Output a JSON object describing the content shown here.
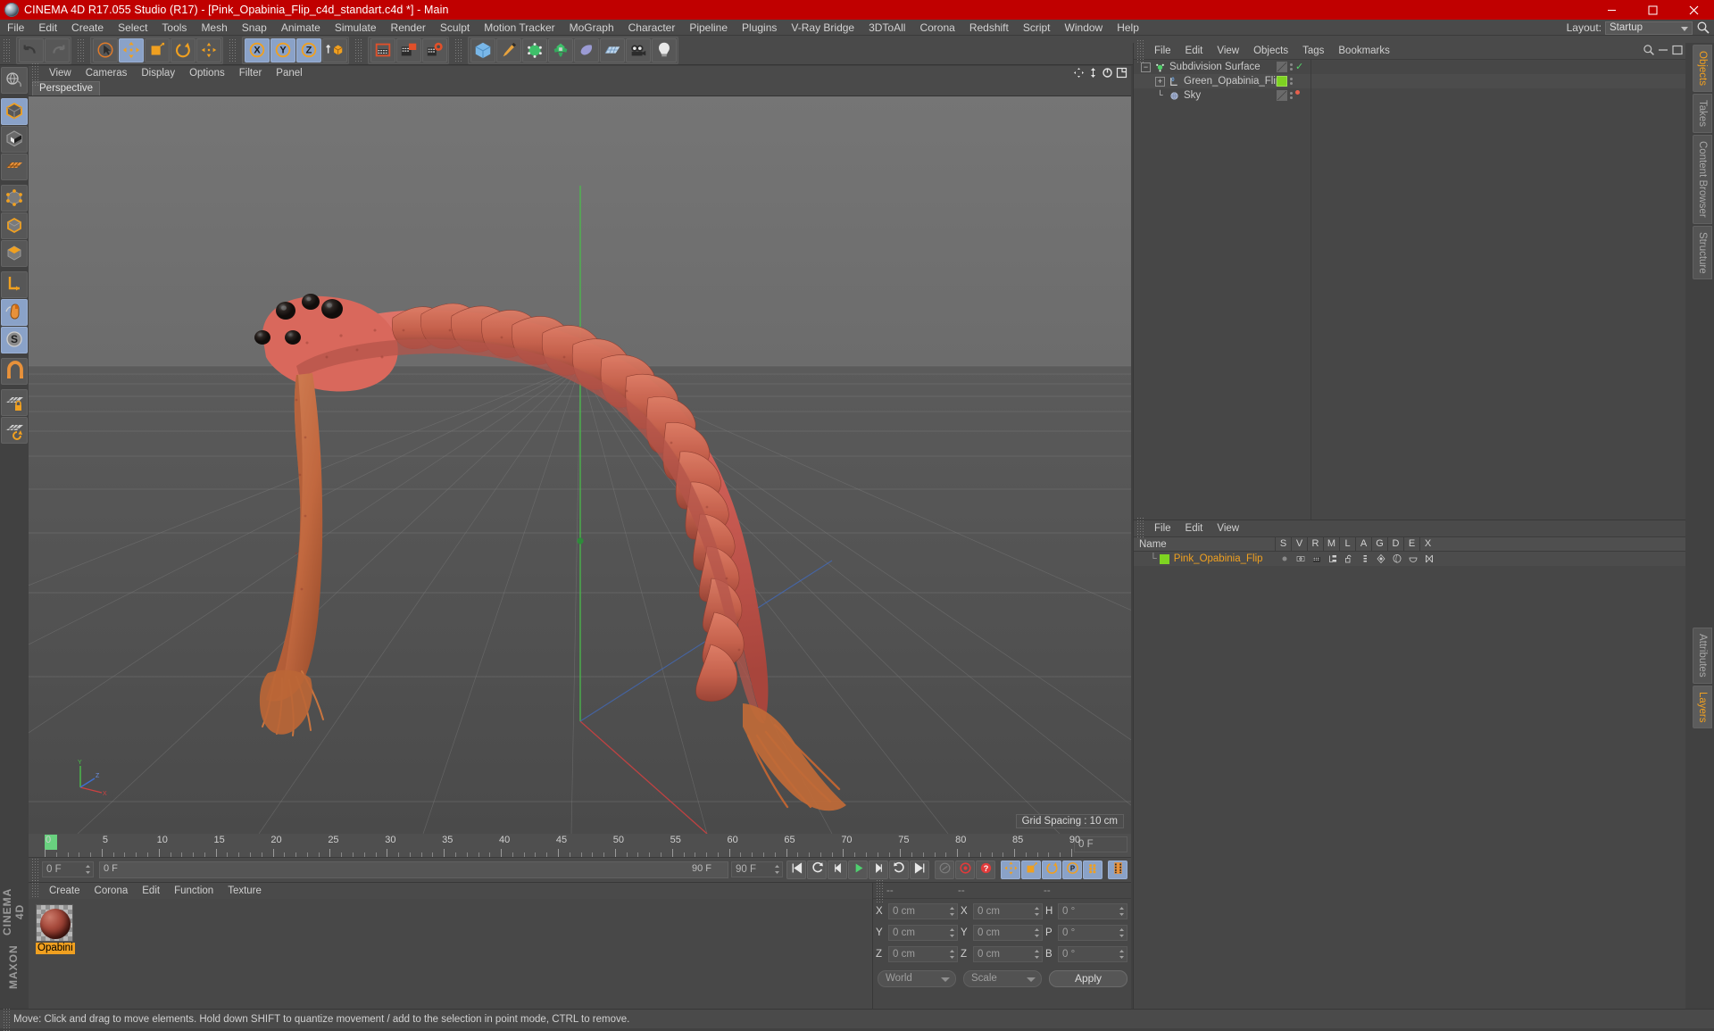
{
  "window": {
    "title": "CINEMA 4D R17.055 Studio (R17) - [Pink_Opabinia_Flip_c4d_standart.c4d *] - Main",
    "minimize": "minimize-icon",
    "maximize": "maximize-icon",
    "close": "close-icon",
    "accent_red": "#c00000"
  },
  "menubar": {
    "items": [
      "File",
      "Edit",
      "Create",
      "Select",
      "Tools",
      "Mesh",
      "Snap",
      "Animate",
      "Simulate",
      "Render",
      "Sculpt",
      "Motion Tracker",
      "MoGraph",
      "Character",
      "Pipeline",
      "Plugins",
      "V-Ray Bridge",
      "3DToAll",
      "Corona",
      "Redshift",
      "Script",
      "Window",
      "Help"
    ],
    "layout_label": "Layout:",
    "layout_value": "Startup",
    "search_icon": "magnifier-icon"
  },
  "toolbar": {
    "groups": [
      {
        "name": "undo-redo",
        "buttons": [
          {
            "name": "undo-button",
            "icon": "undo-arrow-icon",
            "active": false
          },
          {
            "name": "redo-button",
            "icon": "redo-arrow-icon",
            "active": false
          }
        ]
      },
      {
        "name": "transform-tools",
        "buttons": [
          {
            "name": "live-selection-tool",
            "icon": "cursor-circle-icon",
            "active": false
          },
          {
            "name": "move-tool",
            "icon": "move-cross-icon",
            "active": true
          },
          {
            "name": "scale-tool",
            "icon": "scale-box-icon",
            "active": false
          },
          {
            "name": "rotate-tool",
            "icon": "rotate-circle-icon",
            "active": false
          },
          {
            "name": "free-move-tool",
            "icon": "move-cross-alt-icon",
            "active": false
          }
        ]
      },
      {
        "name": "axis-locks",
        "buttons": [
          {
            "name": "lock-x-axis",
            "icon": "x-axis-icon",
            "active": true
          },
          {
            "name": "lock-y-axis",
            "icon": "y-axis-icon",
            "active": true
          },
          {
            "name": "lock-z-axis",
            "icon": "z-axis-icon",
            "active": true
          },
          {
            "name": "world-object-coordinates",
            "icon": "world-cube-icon",
            "active": false
          }
        ]
      },
      {
        "name": "render-tools",
        "buttons": [
          {
            "name": "render-view-button",
            "icon": "clapper-icon",
            "active": false
          },
          {
            "name": "render-to-picture-viewer-button",
            "icon": "clapper-picture-icon",
            "active": false
          },
          {
            "name": "render-settings-button",
            "icon": "clapper-gear-icon",
            "active": false
          }
        ]
      },
      {
        "name": "create-objects",
        "buttons": [
          {
            "name": "add-cube-button",
            "icon": "cube-icon",
            "active": false
          },
          {
            "name": "add-spline-button",
            "icon": "pen-icon",
            "active": false
          },
          {
            "name": "generator-button",
            "icon": "green-cube-icon",
            "active": false
          },
          {
            "name": "deformer-button",
            "icon": "green-crystal-icon",
            "active": false
          },
          {
            "name": "scene-object-button",
            "icon": "purple-shape-icon",
            "active": false
          },
          {
            "name": "environment-button",
            "icon": "floor-grid-icon",
            "active": false
          },
          {
            "name": "camera-button",
            "icon": "camera-icon",
            "active": false
          },
          {
            "name": "light-button",
            "icon": "light-bulb-icon",
            "active": false
          }
        ]
      }
    ]
  },
  "leftrail": {
    "groups": [
      [
        {
          "name": "viewport-rotate-tool",
          "icon": "globe-rotate-icon",
          "active": false
        }
      ],
      [
        {
          "name": "model-mode-tool",
          "icon": "model-cube-icon",
          "active": true
        },
        {
          "name": "texture-mode-tool",
          "icon": "texture-cube-icon",
          "active": false
        },
        {
          "name": "uv-mesh-tool",
          "icon": "uv-mesh-icon",
          "active": false
        }
      ],
      [
        {
          "name": "points-mode-tool",
          "icon": "points-cube-icon",
          "active": false
        },
        {
          "name": "edges-mode-tool",
          "icon": "edges-cube-icon",
          "active": false
        },
        {
          "name": "polygons-mode-tool",
          "icon": "polygons-cube-icon",
          "active": false
        }
      ],
      [
        {
          "name": "object-axis-tool",
          "icon": "axis-l-icon",
          "active": false
        },
        {
          "name": "viewport-solo-tool",
          "icon": "mouse-icon",
          "active": true
        },
        {
          "name": "enable-snapping-tool",
          "icon": "s-circle-icon",
          "active": true
        }
      ],
      [
        {
          "name": "magnet-tool",
          "icon": "magnet-icon",
          "active": false
        }
      ],
      [
        {
          "name": "lock-workplane-tool",
          "icon": "grid-lock-icon",
          "active": false
        },
        {
          "name": "workplane-rotate-tool",
          "icon": "grid-rotate-icon",
          "active": false
        }
      ]
    ],
    "brand_top": "MAXON",
    "brand_bottom": "CINEMA 4D"
  },
  "viewport": {
    "menu": [
      "View",
      "Cameras",
      "Display",
      "Options",
      "Filter",
      "Panel"
    ],
    "tab": "Perspective",
    "grid_spacing": "Grid Spacing : 10 cm",
    "axis_labels": {
      "y": "Y",
      "x": "X",
      "z": "Z"
    },
    "icons": [
      "move-viewport-icon",
      "pan-viewport-icon",
      "rotate-viewport-icon",
      "layout-viewport-icon"
    ]
  },
  "timeline": {
    "ticks": [
      "0",
      "5",
      "10",
      "15",
      "20",
      "25",
      "30",
      "35",
      "40",
      "45",
      "50",
      "55",
      "60",
      "65",
      "70",
      "75",
      "80",
      "85",
      "90"
    ],
    "current_frame_field": "0 F",
    "start_field": "0 F",
    "preview_start": "0 F",
    "preview_end": "90 F",
    "end_field": "90 F",
    "transport": [
      {
        "name": "go-to-start-button",
        "icon": "skip-start-icon"
      },
      {
        "name": "play-backwards-button",
        "icon": "play-back-icon"
      },
      {
        "name": "step-back-button",
        "icon": "step-back-icon"
      },
      {
        "name": "play-forward-button",
        "icon": "play-icon"
      },
      {
        "name": "step-forward-button",
        "icon": "step-forward-icon"
      },
      {
        "name": "play-loop-button",
        "icon": "loop-icon"
      },
      {
        "name": "go-to-end-button",
        "icon": "skip-end-icon"
      }
    ],
    "record_group": [
      {
        "name": "autokeying-button",
        "icon": "autokey-icon",
        "active": false
      },
      {
        "name": "record-active-objects-button",
        "icon": "record-red-icon",
        "active": false
      },
      {
        "name": "keyframe-selection-button",
        "icon": "question-red-icon",
        "active": false
      }
    ],
    "key_group": [
      {
        "name": "record-position-button",
        "icon": "position-cross-icon",
        "active": true
      },
      {
        "name": "record-scale-button",
        "icon": "scale-key-icon",
        "active": true
      },
      {
        "name": "record-rotation-button",
        "icon": "rotation-key-icon",
        "active": true
      },
      {
        "name": "record-pla-button",
        "icon": "pla-p-icon",
        "active": true
      },
      {
        "name": "record-parameter-button",
        "icon": "param-dots-icon",
        "active": true
      }
    ],
    "extra": [
      {
        "name": "keyframe-toggle-button",
        "icon": "film-strip-icon",
        "active": true
      }
    ]
  },
  "material_manager": {
    "menu": [
      "Create",
      "Corona",
      "Edit",
      "Function",
      "Texture"
    ],
    "materials": [
      {
        "name": "Opabini",
        "thumb": "material-sphere-thumbnail"
      }
    ]
  },
  "coordinates": {
    "header": [
      "--",
      "--",
      "--"
    ],
    "rows": [
      {
        "pos_label": "X",
        "pos_value": "0 cm",
        "size_label": "X",
        "size_value": "0 cm",
        "rot_label": "H",
        "rot_value": "0 °"
      },
      {
        "pos_label": "Y",
        "pos_value": "0 cm",
        "size_label": "Y",
        "size_value": "0 cm",
        "rot_label": "P",
        "rot_value": "0 °"
      },
      {
        "pos_label": "Z",
        "pos_value": "0 cm",
        "size_label": "Z",
        "size_value": "0 cm",
        "rot_label": "B",
        "rot_value": "0 °"
      }
    ],
    "system_dropdown": "World",
    "mode_dropdown": "Scale",
    "apply_button": "Apply"
  },
  "object_manager": {
    "menu": [
      "File",
      "Edit",
      "View",
      "Objects",
      "Tags",
      "Bookmarks"
    ],
    "objects": [
      {
        "name": "Subdivision Surface",
        "icon": "subdivision-surface-icon",
        "indent": 0,
        "tag": "checker",
        "marker": "check",
        "marker_color": "#55d46a"
      },
      {
        "name": "Green_Opabinia_Flip",
        "icon": "polygon-object-icon",
        "indent": 1,
        "tag": "green",
        "marker": "none",
        "marker_color": ""
      },
      {
        "name": "Sky",
        "icon": "sky-sphere-icon",
        "indent": 1,
        "tag": "checker",
        "marker": "dot",
        "marker_color": "#e8604c"
      }
    ]
  },
  "layer_manager": {
    "menu": [
      "File",
      "Edit",
      "View"
    ],
    "columns": [
      "Name",
      "S",
      "V",
      "R",
      "M",
      "L",
      "A",
      "G",
      "D",
      "E",
      "X"
    ],
    "rows": [
      {
        "name": "Pink_Opabinia_Flip",
        "color": "#7ed321",
        "icons": [
          "solo-dot-icon",
          "view-eye-icon",
          "render-clapper-icon",
          "manager-icon",
          "lock-open-icon",
          "animation-icon",
          "generator-icon",
          "deformer-icon",
          "expression-icon",
          "xpresso-icon"
        ]
      }
    ]
  },
  "right_tabs": {
    "top": [
      {
        "label": "Objects",
        "active": true
      },
      {
        "label": "Takes",
        "active": false
      },
      {
        "label": "Content Browser",
        "active": false
      },
      {
        "label": "Structure",
        "active": false
      }
    ],
    "bottom": [
      {
        "label": "Attributes",
        "active": false
      },
      {
        "label": "Layers",
        "active": true
      }
    ]
  },
  "status_bar": {
    "text": "Move: Click and drag to move elements. Hold down SHIFT to quantize movement / add to the selection in point mode, CTRL to remove."
  }
}
